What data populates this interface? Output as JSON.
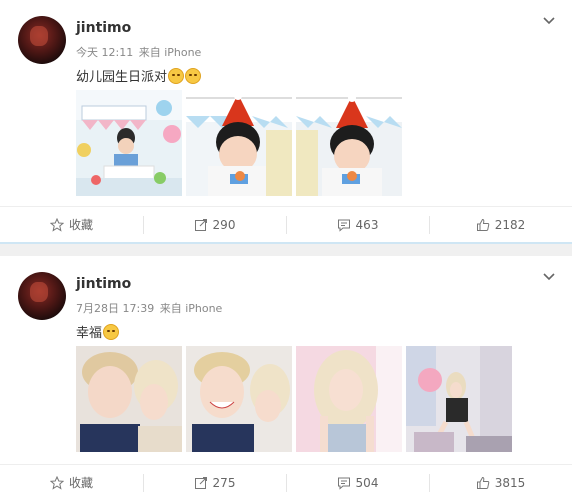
{
  "posts": [
    {
      "username": "jintimo",
      "time": "今天 12:11",
      "source": "来自 iPhone",
      "text": "幼儿园生日派对",
      "emoji_count": 2,
      "actions": {
        "favorite": "收藏",
        "repost": "290",
        "comment": "463",
        "like": "2182"
      },
      "photos": [
        "birthday-party-table",
        "boy-with-party-hat",
        "boy-with-party-hat-closeup"
      ]
    },
    {
      "username": "jintimo",
      "time": "7月28日 17:39",
      "source": "来自 iPhone",
      "text": "幸福",
      "emoji_count": 1,
      "actions": {
        "favorite": "收藏",
        "repost": "275",
        "comment": "504",
        "like": "3815"
      },
      "photos": [
        "couple-selfie",
        "couple-selfie-smiling",
        "blonde-woman-portrait",
        "woman-in-room"
      ]
    }
  ],
  "colors": {
    "accent_divider": "#cfe6f4",
    "text": "#333333",
    "meta": "#888888"
  },
  "icons": [
    "chevron-down-icon",
    "star-icon",
    "repost-icon",
    "comment-icon",
    "like-icon"
  ]
}
